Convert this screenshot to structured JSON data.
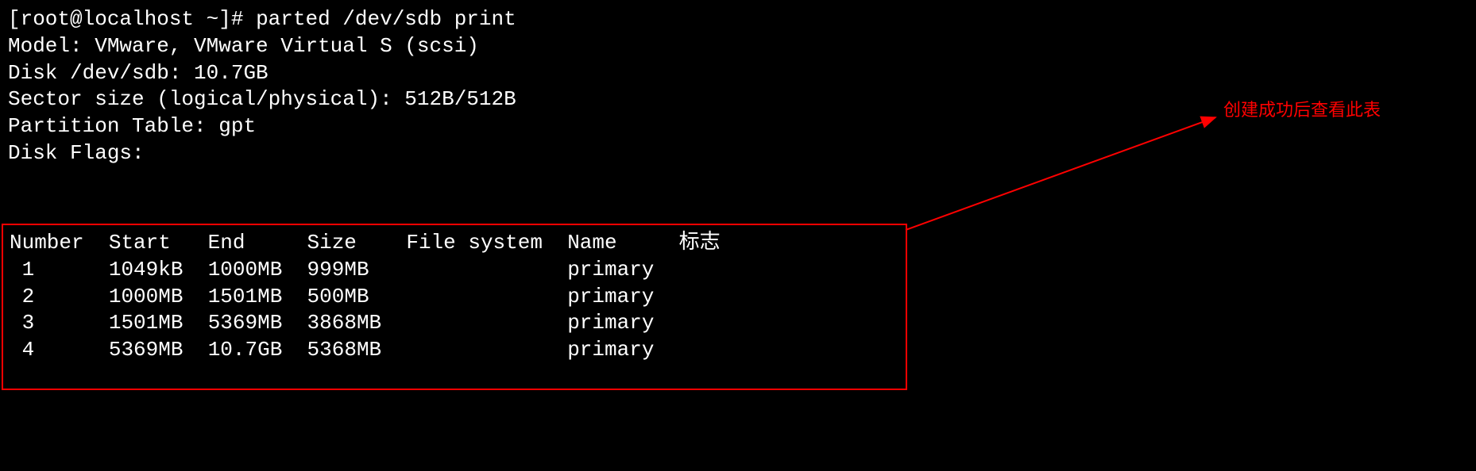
{
  "prompt": {
    "user_host": "[root@localhost ~]#",
    "command": "parted /dev/sdb print"
  },
  "output": {
    "model_line": "Model: VMware, VMware Virtual S (scsi)",
    "disk_line": "Disk /dev/sdb: 10.7GB",
    "sector_line": "Sector size (logical/physical): 512B/512B",
    "partition_table_line": "Partition Table: gpt",
    "disk_flags_line": "Disk Flags:"
  },
  "table": {
    "headers": {
      "number": "Number",
      "start": "Start",
      "end": "End",
      "size": "Size",
      "file_system": "File system",
      "name": "Name",
      "flags": "标志"
    },
    "rows": [
      {
        "number": "1",
        "start": "1049kB",
        "end": "1000MB",
        "size": "999MB",
        "file_system": "",
        "name": "primary",
        "flags": ""
      },
      {
        "number": "2",
        "start": "1000MB",
        "end": "1501MB",
        "size": "500MB",
        "file_system": "",
        "name": "primary",
        "flags": ""
      },
      {
        "number": "3",
        "start": "1501MB",
        "end": "5369MB",
        "size": "3868MB",
        "file_system": "",
        "name": "primary",
        "flags": ""
      },
      {
        "number": "4",
        "start": "5369MB",
        "end": "10.7GB",
        "size": "5368MB",
        "file_system": "",
        "name": "primary",
        "flags": ""
      }
    ]
  },
  "annotation": {
    "text": "创建成功后查看此表"
  }
}
